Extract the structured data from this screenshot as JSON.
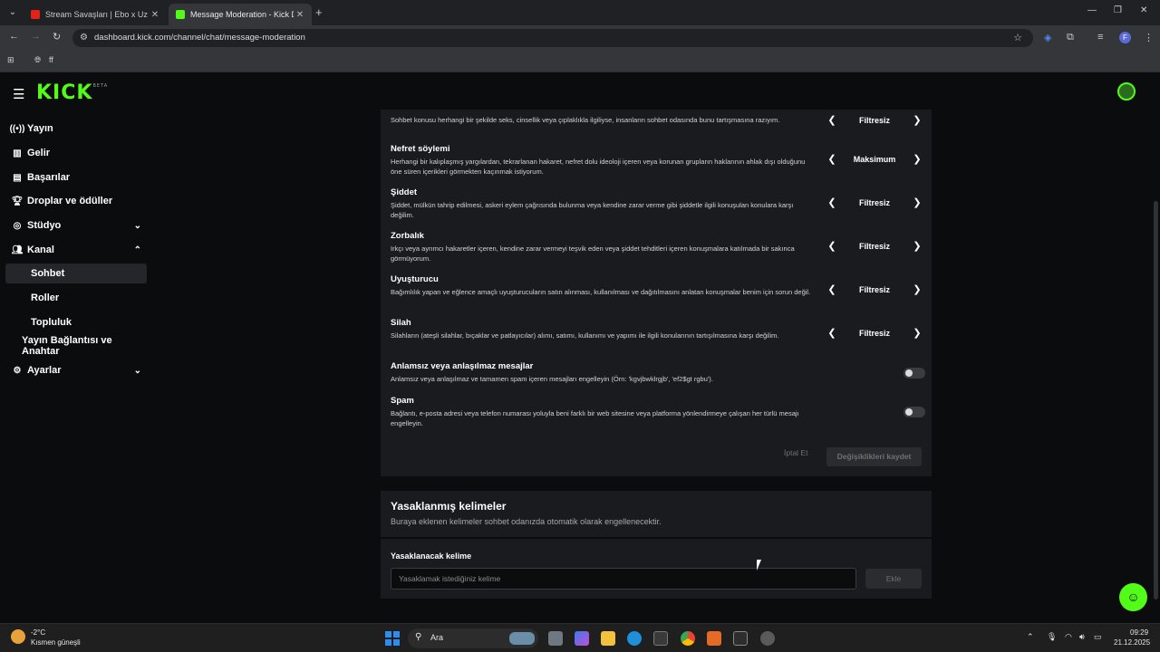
{
  "browser": {
    "tabs": [
      {
        "title": "Stream Savaşları | Ebo x Uz",
        "active": false
      },
      {
        "title": "Message Moderation - Kick Da",
        "active": true
      }
    ],
    "url": "dashboard.kick.com/channel/chat/message-moderation",
    "bookmark": "ff",
    "profile_initial": "F"
  },
  "app": {
    "logo": "KICK",
    "logo_badge": "BETA"
  },
  "sidebar": {
    "items": [
      {
        "label": "Yayın"
      },
      {
        "label": "Gelir"
      },
      {
        "label": "Başarılar"
      },
      {
        "label": "Droplar ve ödüller"
      },
      {
        "label": "Stüdyo"
      },
      {
        "label": "Kanal"
      },
      {
        "label": "Sohbet"
      },
      {
        "label": "Roller"
      },
      {
        "label": "Topluluk"
      },
      {
        "label": "Yayın Bağlantısı ve Anahtar"
      },
      {
        "label": "Ayarlar"
      }
    ]
  },
  "moderation": {
    "rows": [
      {
        "title": "",
        "desc": "Sohbet konusu herhangi bir şekilde seks, cinsellik veya çıplaklıkla ilgiliyse, insanların sohbet odasında bunu tartışmasına razıyım.",
        "value": "Filtresiz"
      },
      {
        "title": "Nefret söylemi",
        "desc": "Herhangi bir kalıplaşmış yargılardan, tekrarlanan hakaret, nefret dolu ideoloji içeren veya korunan grupların haklarının ahlak dışı olduğunu öne süren içerikleri görmekten kaçınmak istiyorum.",
        "value": "Maksimum"
      },
      {
        "title": "Şiddet",
        "desc": "Şiddet, mülkün tahrip edilmesi, askeri eylem çağrısında bulunma veya kendine zarar verme gibi şiddetle ilgili konuşulan konulara karşı değilim.",
        "value": "Filtresiz"
      },
      {
        "title": "Zorbalık",
        "desc": "Irkçı veya ayrımcı hakaretler içeren, kendine zarar vermeyi teşvik eden veya şiddet tehditleri içeren konuşmalara katılmada bir sakınca görmüyorum.",
        "value": "Filtresiz"
      },
      {
        "title": "Uyuşturucu",
        "desc": "Bağımlılık yapan ve eğlence amaçlı uyuşturucuların satın alınması, kullanılması ve dağıtılmasını anlatan konuşmalar benim için sorun değil.",
        "value": "Filtresiz"
      },
      {
        "title": "Silah",
        "desc": "Silahların (ateşli silahlar, bıçaklar ve patlayıcılar) alımı, satımı, kullanımı ve yapımı ile ilgili konularının tartışılmasına karşı değilim.",
        "value": "Filtresiz"
      }
    ],
    "toggles": [
      {
        "title": "Anlamsız veya anlaşılmaz mesajlar",
        "desc": "Anlamsız veya anlaşılmaz ve tamamen spam içeren mesajları engelleyin (Örn: 'kgvjbwklrgjb', 'ef2$gt rgbu').",
        "on": false
      },
      {
        "title": "Spam",
        "desc": "Bağlantı, e-posta adresi veya telefon numarası yoluyla beni farklı bir web sitesine veya platforma yönlendirmeye çalışan her türlü mesajı engelleyin.",
        "on": false
      }
    ],
    "cancel_label": "İptal Et",
    "save_label": "Değişiklikleri kaydet"
  },
  "banned_words": {
    "title": "Yasaklanmış kelimeler",
    "subtitle": "Buraya eklenen kelimeler sohbet odanızda otomatik olarak engellenecektir.",
    "input_label": "Yasaklanacak kelime",
    "input_placeholder": "Yasaklamak istediğiniz kelime",
    "add_label": "Ekle"
  },
  "taskbar": {
    "temperature": "-2°C",
    "weather": "Kısmen güneşli",
    "search_label": "Ara",
    "time": "09:29",
    "date": "21.12.2025"
  },
  "colors": {
    "brand": "#53fc18",
    "background": "#0b0c0e",
    "panel": "#191b1f"
  }
}
